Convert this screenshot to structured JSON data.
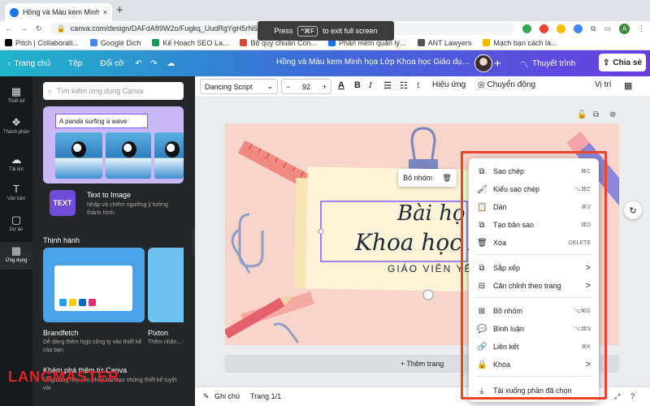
{
  "browser": {
    "tab_title": "Hồng và Màu kem Minh họa Lớ",
    "new_tab": "+",
    "url": "canva.com/design/DAFdAfI9W2o/Fugkq_UudRgYgH5rN6z-Yg/ed",
    "fullscreen_toast": {
      "press": "Press",
      "key": "^⌘F",
      "message": "to exit full screen"
    },
    "profile_initial": "A",
    "bookmarks": [
      {
        "label": "Pitch | Collaborati...",
        "color": "#000000"
      },
      {
        "label": "Google Dịch",
        "color": "#4285f4"
      },
      {
        "label": "Kế Hoạch SEO La...",
        "color": "#0f9d58"
      },
      {
        "label": "Bộ quy chuẩn Con...",
        "color": "#db4437"
      },
      {
        "label": "Phân mềm quản lý...",
        "color": "#1a73e8"
      },
      {
        "label": "ANT Lawyers",
        "color": "#555555"
      },
      {
        "label": "Mạch bạn cách là...",
        "color": "#f4b400"
      }
    ]
  },
  "header": {
    "home": "Trang chủ",
    "file": "Tệp",
    "resize": "Đổi cỡ",
    "doc_title": "Hồng và Màu kem Minh họa Lớp Khoa học Giáo dục Bài thu...",
    "plus": "+",
    "present": "Thuyết trình",
    "share": "Chia sẻ"
  },
  "rail": [
    {
      "label": "Thiết kế",
      "icon": "▦"
    },
    {
      "label": "Thành phần",
      "icon": "❖"
    },
    {
      "label": "Tải lên",
      "icon": "☁"
    },
    {
      "label": "Văn bản",
      "icon": "T"
    },
    {
      "label": "Dự án",
      "icon": "▢"
    },
    {
      "label": "Ứng dụng",
      "icon": "▦"
    }
  ],
  "panel": {
    "search_placeholder": "Tìm kiếm ứng dụng Canva",
    "prompt_text": "A panda surfing a wave",
    "t2i_icon_text": "TEXT",
    "t2i_name": "Text to Image",
    "t2i_desc": "Nhập và chiêm ngưỡng ý tưởng thành hình.",
    "trending": "Thịnh hành",
    "app1_name": "Brandfetch",
    "app1_desc": "Dễ dàng thêm logo công ty vào thiết kế của bạn",
    "app2_name": "Pixton",
    "app2_desc": "Thêm nhân... cho thiết kế",
    "explore_title": "Khám phá thêm từ Canva",
    "explore_desc": "Ứng dụng này cho phép bạn tạo những thiết kế tuyệt vời",
    "watermark": "LANGMASTER"
  },
  "toolbar": {
    "font": "Dancing Script",
    "size_minus": "−",
    "size": "92",
    "size_plus": "+",
    "effects": "Hiệu ứng",
    "animate": "Chuyển động",
    "position": "Vị trí"
  },
  "canvas": {
    "title_line1": "Bài họ",
    "title_line2": "Khoa học Xã",
    "subtitle": "GIÁO VIÊN YẾN",
    "group_btn": "Bỏ nhóm"
  },
  "add_page": "+ Thêm trang",
  "status": {
    "notes": "Ghi chú",
    "page": "Trang 1/1"
  },
  "context_menu": [
    {
      "label": "Sao chép",
      "shortcut": "⌘C",
      "icon": "⧉"
    },
    {
      "label": "Kiểu sao chép",
      "shortcut": "⌥⌘C",
      "icon": "🖌"
    },
    {
      "label": "Dán",
      "shortcut": "⌘V",
      "icon": "📋"
    },
    {
      "label": "Tạo bản sao",
      "shortcut": "⌘D",
      "icon": "⧉"
    },
    {
      "label": "Xóa",
      "shortcut": "DELETE",
      "icon": "🗑"
    },
    {
      "label": "Sắp xếp",
      "shortcut": ">",
      "icon": "⧉"
    },
    {
      "label": "Căn chỉnh theo trang",
      "shortcut": ">",
      "icon": "⊟"
    },
    {
      "label": "Bỏ nhóm",
      "shortcut": "⌥⌘G",
      "icon": "⊞"
    },
    {
      "label": "Bình luận",
      "shortcut": "⌥⌘N",
      "icon": "💬"
    },
    {
      "label": "Liên kết",
      "shortcut": "⌘K",
      "icon": "🔗"
    },
    {
      "label": "Khóa",
      "shortcut": ">",
      "icon": "🔒"
    },
    {
      "label": "Tải xuống phần đã chọn",
      "shortcut": "",
      "icon": "⤓"
    }
  ]
}
